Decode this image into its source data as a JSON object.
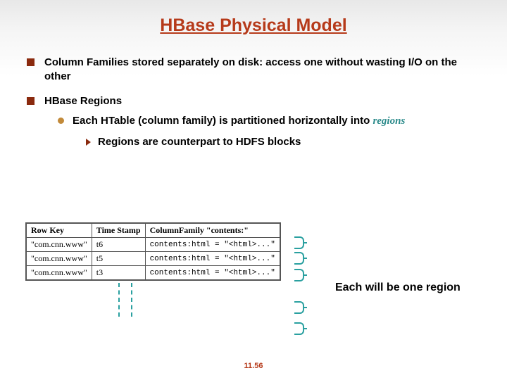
{
  "title": "HBase Physical Model",
  "bullets": {
    "b1": "Column Families stored separately on disk: access one without wasting I/O on the other",
    "b2": "HBase Regions",
    "b2_sub": {
      "pre": "Each HTable (column family) is partitioned horizontally into ",
      "regions_word": "regions",
      "sub_sub": "Regions are counterpart to HDFS blocks"
    }
  },
  "table": {
    "headers": {
      "c1": "Row Key",
      "c2": "Time Stamp",
      "c3": "ColumnFamily \"contents:\""
    },
    "rows": [
      {
        "rk": "\"com.cnn.www\"",
        "ts": "t6",
        "cf": "contents:html = \"<html>...\""
      },
      {
        "rk": "\"com.cnn.www\"",
        "ts": "t5",
        "cf": "contents:html = \"<html>...\""
      },
      {
        "rk": "\"com.cnn.www\"",
        "ts": "t3",
        "cf": "contents:html = \"<html>...\""
      }
    ]
  },
  "region_label": "Each will be one region",
  "slide_number": "11.56"
}
